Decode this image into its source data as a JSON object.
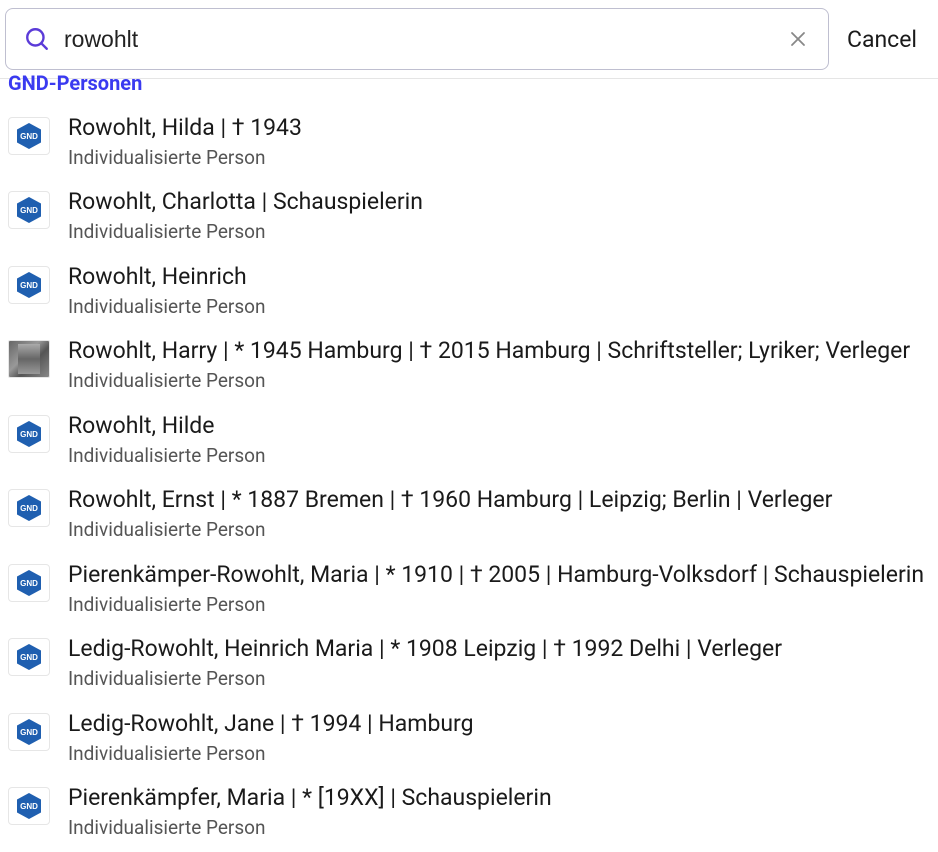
{
  "search": {
    "value": "rowohlt",
    "placeholder": "",
    "cancel_label": "Cancel"
  },
  "section": {
    "header": "GND-Personen"
  },
  "badge_label": "GND",
  "colors": {
    "badge_hex": "#1f5fb0",
    "accent": "#5b3bd8",
    "section_header": "#3a3af0"
  },
  "results": [
    {
      "title": "Rowohlt, Hilda | † 1943",
      "subtitle": "Individualisierte Person",
      "icon": "gnd"
    },
    {
      "title": "Rowohlt, Charlotta | Schauspielerin",
      "subtitle": "Individualisierte Person",
      "icon": "gnd"
    },
    {
      "title": "Rowohlt, Heinrich",
      "subtitle": "Individualisierte Person",
      "icon": "gnd"
    },
    {
      "title": "Rowohlt, Harry | * 1945 Hamburg | † 2015 Hamburg | Schriftsteller; Lyriker; Verleger",
      "subtitle": "Individualisierte Person",
      "icon": "photo"
    },
    {
      "title": "Rowohlt, Hilde",
      "subtitle": "Individualisierte Person",
      "icon": "gnd"
    },
    {
      "title": "Rowohlt, Ernst | * 1887 Bremen | † 1960 Hamburg | Leipzig; Berlin | Verleger",
      "subtitle": "Individualisierte Person",
      "icon": "gnd"
    },
    {
      "title": "Pierenkämper-Rowohlt, Maria | * 1910 | † 2005 | Hamburg-Volksdorf | Schauspielerin",
      "subtitle": "Individualisierte Person",
      "icon": "gnd"
    },
    {
      "title": "Ledig-Rowohlt, Heinrich Maria | * 1908 Leipzig | † 1992 Delhi | Verleger",
      "subtitle": "Individualisierte Person",
      "icon": "gnd"
    },
    {
      "title": "Ledig-Rowohlt, Jane | † 1994 | Hamburg",
      "subtitle": "Individualisierte Person",
      "icon": "gnd"
    },
    {
      "title": "Pierenkämpfer, Maria | * [19XX] | Schauspielerin",
      "subtitle": "Individualisierte Person",
      "icon": "gnd"
    }
  ]
}
